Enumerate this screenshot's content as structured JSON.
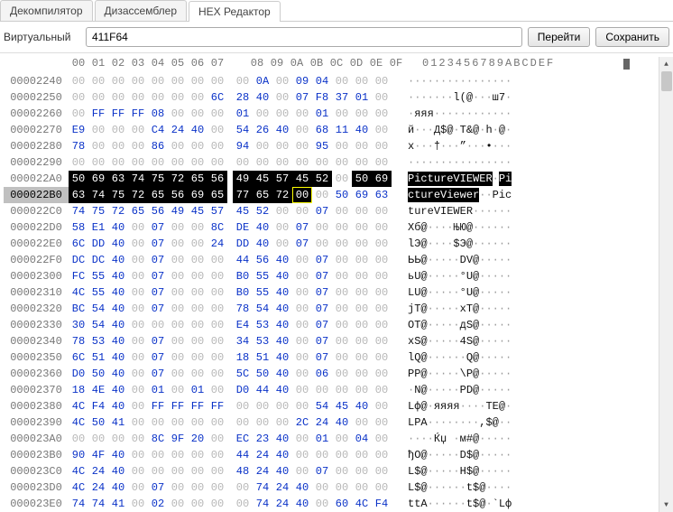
{
  "tabs": [
    {
      "label": "Декомпилятор",
      "active": false
    },
    {
      "label": "Дизассемблер",
      "active": false
    },
    {
      "label": "HEX Редактор",
      "active": true
    }
  ],
  "toolbar": {
    "label": "Виртуальный",
    "input": "411F64",
    "go": "Перейти",
    "save": "Сохранить"
  },
  "header": {
    "bytes": [
      "00",
      "01",
      "02",
      "03",
      "04",
      "05",
      "06",
      "07",
      "08",
      "09",
      "0A",
      "0B",
      "0C",
      "0D",
      "0E",
      "0F"
    ],
    "ascii": "0123456789ABCDEF"
  },
  "caret_ascii_col": 11,
  "rows": [
    {
      "off": "00002240",
      "b": [
        "00",
        "00",
        "00",
        "00",
        "00",
        "00",
        "00",
        "00",
        "00",
        "0A",
        "00",
        "09",
        "04",
        "00",
        "00",
        "00"
      ],
      "a": "················",
      "hl": []
    },
    {
      "off": "00002250",
      "b": [
        "00",
        "00",
        "00",
        "00",
        "00",
        "00",
        "00",
        "6C",
        "28",
        "40",
        "00",
        "07",
        "F8",
        "37",
        "01",
        "00"
      ],
      "a": "·······l(@···ш7·",
      "hl": []
    },
    {
      "off": "00002260",
      "b": [
        "00",
        "FF",
        "FF",
        "FF",
        "08",
        "00",
        "00",
        "00",
        "01",
        "00",
        "00",
        "00",
        "01",
        "00",
        "00",
        "00"
      ],
      "a": "·яяя············",
      "hl": []
    },
    {
      "off": "00002270",
      "b": [
        "E9",
        "00",
        "00",
        "00",
        "C4",
        "24",
        "40",
        "00",
        "54",
        "26",
        "40",
        "00",
        "68",
        "11",
        "40",
        "00"
      ],
      "a": "й···Д$@·T&@·h·@·",
      "hl": []
    },
    {
      "off": "00002280",
      "b": [
        "78",
        "00",
        "00",
        "00",
        "86",
        "00",
        "00",
        "00",
        "94",
        "00",
        "00",
        "00",
        "95",
        "00",
        "00",
        "00"
      ],
      "a": "x···†···”···•···",
      "hl": []
    },
    {
      "off": "00002290",
      "b": [
        "00",
        "00",
        "00",
        "00",
        "00",
        "00",
        "00",
        "00",
        "00",
        "00",
        "00",
        "00",
        "00",
        "00",
        "00",
        "00"
      ],
      "a": "················",
      "hl": []
    },
    {
      "off": "000022A0",
      "b": [
        "50",
        "69",
        "63",
        "74",
        "75",
        "72",
        "65",
        "56",
        "49",
        "45",
        "57",
        "45",
        "52",
        "00",
        "50",
        "69"
      ],
      "a": "PictureVIEWER·Pi",
      "hl": [
        0,
        1,
        2,
        3,
        4,
        5,
        6,
        7,
        8,
        9,
        10,
        11,
        12,
        14,
        15
      ]
    },
    {
      "off": "000022B0",
      "b": [
        "63",
        "74",
        "75",
        "72",
        "65",
        "56",
        "69",
        "65",
        "77",
        "65",
        "72",
        "00",
        "00",
        "50",
        "69",
        "63"
      ],
      "a": "ctureViewer··Pic",
      "hl": [
        0,
        1,
        2,
        3,
        4,
        5,
        6,
        7,
        8,
        9,
        10
      ],
      "cursor": 11,
      "sel": true
    },
    {
      "off": "000022C0",
      "b": [
        "74",
        "75",
        "72",
        "65",
        "56",
        "49",
        "45",
        "57",
        "45",
        "52",
        "00",
        "00",
        "07",
        "00",
        "00",
        "00"
      ],
      "a": "tureVIEWER······",
      "hl": []
    },
    {
      "off": "000022D0",
      "b": [
        "58",
        "E1",
        "40",
        "00",
        "07",
        "00",
        "00",
        "8C",
        "DE",
        "40",
        "00",
        "07",
        "00",
        "00",
        "00",
        "00"
      ],
      "a": "Xб@····ЊЮ@······",
      "hl": []
    },
    {
      "off": "000022E0",
      "b": [
        "6C",
        "DD",
        "40",
        "00",
        "07",
        "00",
        "00",
        "24",
        "DD",
        "40",
        "00",
        "07",
        "00",
        "00",
        "00",
        "00"
      ],
      "a": "lЭ@····$Э@······",
      "hl": []
    },
    {
      "off": "000022F0",
      "b": [
        "DC",
        "DC",
        "40",
        "00",
        "07",
        "00",
        "00",
        "00",
        "44",
        "56",
        "40",
        "00",
        "07",
        "00",
        "00",
        "00"
      ],
      "a": "ЬЬ@·····DV@·····",
      "hl": []
    },
    {
      "off": "00002300",
      "b": [
        "FC",
        "55",
        "40",
        "00",
        "07",
        "00",
        "00",
        "00",
        "B0",
        "55",
        "40",
        "00",
        "07",
        "00",
        "00",
        "00"
      ],
      "a": "ьU@·····°U@·····",
      "hl": []
    },
    {
      "off": "00002310",
      "b": [
        "4C",
        "55",
        "40",
        "00",
        "07",
        "00",
        "00",
        "00",
        "B0",
        "55",
        "40",
        "00",
        "07",
        "00",
        "00",
        "00"
      ],
      "a": "LU@·····°U@·····",
      "hl": []
    },
    {
      "off": "00002320",
      "b": [
        "BC",
        "54",
        "40",
        "00",
        "07",
        "00",
        "00",
        "00",
        "78",
        "54",
        "40",
        "00",
        "07",
        "00",
        "00",
        "00"
      ],
      "a": "jТ@·····xТ@·····",
      "hl": []
    },
    {
      "off": "00002330",
      "b": [
        "30",
        "54",
        "40",
        "00",
        "00",
        "00",
        "00",
        "00",
        "E4",
        "53",
        "40",
        "00",
        "07",
        "00",
        "00",
        "00"
      ],
      "a": "ОТ@·····дS@·····",
      "hl": []
    },
    {
      "off": "00002340",
      "b": [
        "78",
        "53",
        "40",
        "00",
        "07",
        "00",
        "00",
        "00",
        "34",
        "53",
        "40",
        "00",
        "07",
        "00",
        "00",
        "00"
      ],
      "a": "xS@·····4S@·····",
      "hl": []
    },
    {
      "off": "00002350",
      "b": [
        "6C",
        "51",
        "40",
        "00",
        "07",
        "00",
        "00",
        "00",
        "18",
        "51",
        "40",
        "00",
        "07",
        "00",
        "00",
        "00"
      ],
      "a": "lQ@······Q@·····",
      "hl": []
    },
    {
      "off": "00002360",
      "b": [
        "D0",
        "50",
        "40",
        "00",
        "07",
        "00",
        "00",
        "00",
        "5C",
        "50",
        "40",
        "00",
        "06",
        "00",
        "00",
        "00"
      ],
      "a": "РP@·····\\P@·····",
      "hl": []
    },
    {
      "off": "00002370",
      "b": [
        "18",
        "4E",
        "40",
        "00",
        "01",
        "00",
        "01",
        "00",
        "D0",
        "44",
        "40",
        "00",
        "00",
        "00",
        "00",
        "00"
      ],
      "a": "·N@·····РD@·····",
      "hl": []
    },
    {
      "off": "00002380",
      "b": [
        "4C",
        "F4",
        "40",
        "00",
        "FF",
        "FF",
        "FF",
        "FF",
        "00",
        "00",
        "00",
        "00",
        "54",
        "45",
        "40",
        "00"
      ],
      "a": "Lф@·яяяя····TE@·",
      "hl": []
    },
    {
      "off": "00002390",
      "b": [
        "4C",
        "50",
        "41",
        "00",
        "00",
        "00",
        "00",
        "00",
        "00",
        "00",
        "00",
        "2C",
        "24",
        "40",
        "00",
        "00"
      ],
      "a": "LPA········,$@··",
      "hl": []
    },
    {
      "off": "000023A0",
      "b": [
        "00",
        "00",
        "00",
        "00",
        "8C",
        "9F",
        "20",
        "00",
        "EC",
        "23",
        "40",
        "00",
        "01",
        "00",
        "04",
        "00"
      ],
      "a": "····Ќџ ·м#@·····",
      "hl": []
    },
    {
      "off": "000023B0",
      "b": [
        "90",
        "4F",
        "40",
        "00",
        "00",
        "00",
        "00",
        "00",
        "44",
        "24",
        "40",
        "00",
        "00",
        "00",
        "00",
        "00"
      ],
      "a": "ђO@·····D$@·····",
      "hl": []
    },
    {
      "off": "000023C0",
      "b": [
        "4C",
        "24",
        "40",
        "00",
        "00",
        "00",
        "00",
        "00",
        "48",
        "24",
        "40",
        "00",
        "07",
        "00",
        "00",
        "00"
      ],
      "a": "L$@·····H$@·····",
      "hl": []
    },
    {
      "off": "000023D0",
      "b": [
        "4C",
        "24",
        "40",
        "00",
        "07",
        "00",
        "00",
        "00",
        "00",
        "74",
        "24",
        "40",
        "00",
        "00",
        "00",
        "00"
      ],
      "a": "L$@······t$@····",
      "hl": []
    },
    {
      "off": "000023E0",
      "b": [
        "74",
        "74",
        "41",
        "00",
        "02",
        "00",
        "00",
        "00",
        "00",
        "74",
        "24",
        "40",
        "00",
        "60",
        "4C",
        "F4"
      ],
      "a": "ttA······t$@·`Lф",
      "hl": []
    }
  ]
}
